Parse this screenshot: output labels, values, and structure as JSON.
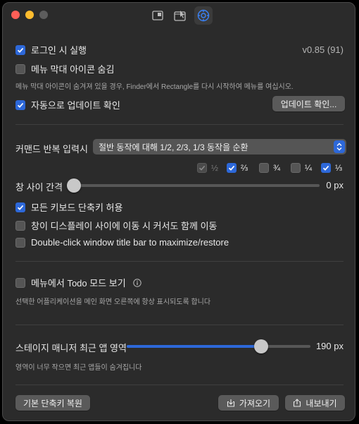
{
  "general": {
    "launch_on_login_label": "로그인 시 실행",
    "launch_on_login_checked": true,
    "version": "v0.85 (91)",
    "hide_menubar_icon_label": "메뉴 막대 아이콘 숨김",
    "hide_menubar_icon_checked": false,
    "hide_menubar_desc": "메뉴 막대 아이콘이 숨겨져 있을 경우, Finder에서 Rectangle를 다시 시작하여 메뉴를 여십시오.",
    "auto_update_label": "자동으로 업데이트 확인",
    "auto_update_checked": true,
    "check_updates_button": "업데이트 확인..."
  },
  "repeat": {
    "label": "커맨드 반복 입력시",
    "selected": "절반 동작에 대해 1/2, 2/3, 1/3 동작을 순환",
    "fractions": [
      {
        "label": "½",
        "checked": true,
        "disabled": true
      },
      {
        "label": "⅔",
        "checked": true,
        "disabled": false
      },
      {
        "label": "¾",
        "checked": false,
        "disabled": false
      },
      {
        "label": "¼",
        "checked": false,
        "disabled": false
      },
      {
        "label": "⅓",
        "checked": true,
        "disabled": false
      }
    ]
  },
  "gap": {
    "label": "창 사이 간격",
    "value_text": "0 px",
    "value": 0
  },
  "shortcuts": {
    "allow_all_label": "모든 키보드 단축키 허용",
    "allow_all_checked": true,
    "move_cursor_label": "창이 디스플레이 사이에 이동 시 커서도 함께 이동",
    "move_cursor_checked": false,
    "double_click_label": "Double-click window title bar to maximize/restore",
    "double_click_checked": false
  },
  "todo": {
    "label": "메뉴에서 Todo 모드 보기",
    "checked": false,
    "info_icon": "info-icon",
    "desc": "선택한 어플리케이션을 메인 화면 오른쪽에 항상 표시되도록 합니다"
  },
  "stage": {
    "label": "스테이지 매니저 최근 앱 영역",
    "value_text": "190 px",
    "fraction": 0.73,
    "desc": "영역이 너무 작으면 최근 앱들이 숨겨집니다"
  },
  "footer": {
    "restore_label": "기본 단축키 복원",
    "import_label": "가져오기",
    "export_label": "내보내기"
  },
  "colors": {
    "accent": "#2d68d9",
    "window_bg": "#2b2b2b"
  }
}
